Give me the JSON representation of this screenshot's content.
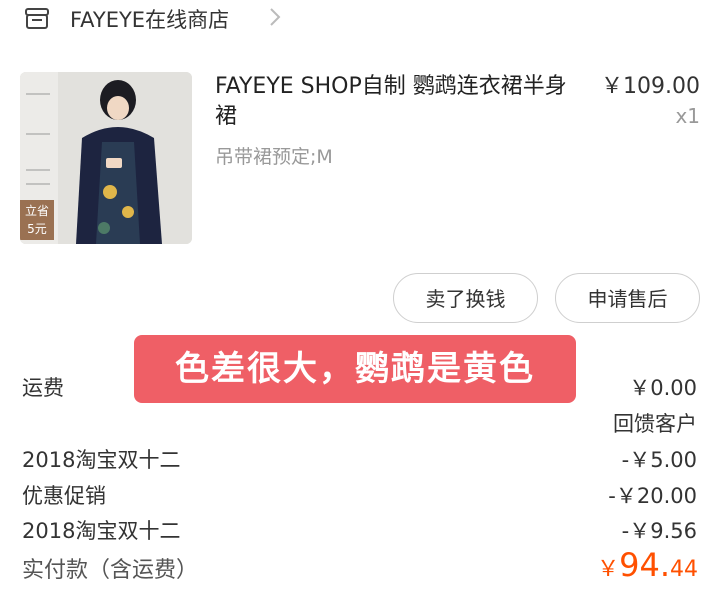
{
  "shop": {
    "name": "FAYEYE在线商店",
    "icon": "shop-icon"
  },
  "product": {
    "title": "FAYEYE SHOP自制 鹦鹉连衣裙半身裙",
    "price": "￥109.00",
    "quantity": "x1",
    "sku": "吊带裙预定;M",
    "thumb_badge_top": "立省",
    "thumb_badge_bottom": "5元"
  },
  "actions": {
    "sell_label": "卖了换钱",
    "after_sale_label": "申请售后"
  },
  "overlay": {
    "text": "色差很大，鹦鹉是黄色"
  },
  "summary": {
    "shipping_label": "运费",
    "shipping_value": "￥0.00",
    "feedback_label": "回馈客户",
    "rows": [
      {
        "label": "2018淘宝双十二",
        "value": "-￥5.00"
      },
      {
        "label": "优惠促销",
        "value": "-￥20.00"
      },
      {
        "label": "2018淘宝双十二",
        "value": "-￥9.56"
      }
    ],
    "total_label": "实付款（含运费）",
    "total_currency": "￥",
    "total_int": "94.",
    "total_dec": "44"
  },
  "colors": {
    "accent": "#ff5000",
    "banner": "#ef5f66",
    "muted": "#999999"
  }
}
